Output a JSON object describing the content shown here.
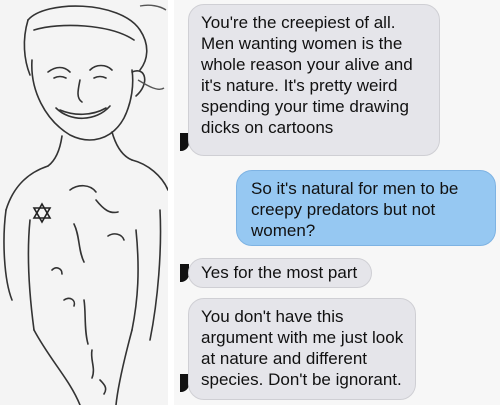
{
  "messages": [
    {
      "side": "received",
      "text": "You're the creepiest of all. Men wanting women is the whole reason your alive and it's nature. It's pretty weird spending your time drawing dicks on cartoons"
    },
    {
      "side": "sent",
      "text": "So it's natural for men to be creepy predators but not women?"
    },
    {
      "side": "received",
      "text": "Yes for the most part"
    },
    {
      "side": "received",
      "text": "You don't have this argument with me just look at nature and different species. Don't be ignorant."
    }
  ],
  "sketch": {
    "description_icon": "hand-drawn-portrait",
    "star_icon": "star-of-david-icon"
  },
  "colors": {
    "received_bubble": "#e5e5ea",
    "sent_bubble": "#96c8f2",
    "background": "#f7f7f7"
  }
}
